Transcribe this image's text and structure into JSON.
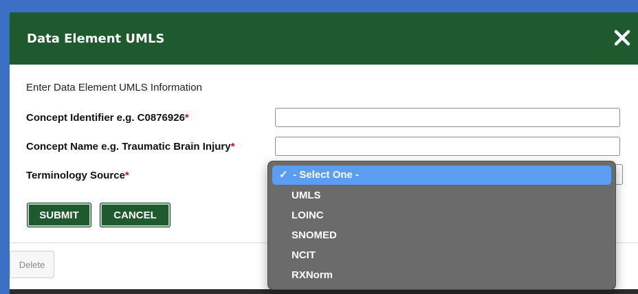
{
  "dialog": {
    "title": "Data Element UMLS",
    "intro": "Enter Data Element UMLS Information",
    "fields": [
      {
        "label": "Concept Identifier e.g. C0876926",
        "required_mark": "*",
        "value": ""
      },
      {
        "label": "Concept Name e.g. Traumatic Brain Injury",
        "required_mark": "*",
        "value": ""
      },
      {
        "label": "Terminology Source",
        "required_mark": "*",
        "selected": "- Select One -"
      }
    ],
    "buttons": {
      "submit": "SUBMIT",
      "cancel": "CANCEL"
    },
    "close_icon": "close-icon"
  },
  "background": {
    "delete_label": "Delete"
  },
  "dropdown": {
    "check_mark": "✓",
    "options": [
      "- Select One -",
      "UMLS",
      "LOINC",
      "SNOMED",
      "NCIT",
      "RXNorm"
    ],
    "selected_index": 0
  },
  "colors": {
    "header_green": "#1f5a2e",
    "required_red": "#c4161c",
    "selected_blue": "#5b9df0",
    "frame_blue": "#3a6fc4"
  }
}
